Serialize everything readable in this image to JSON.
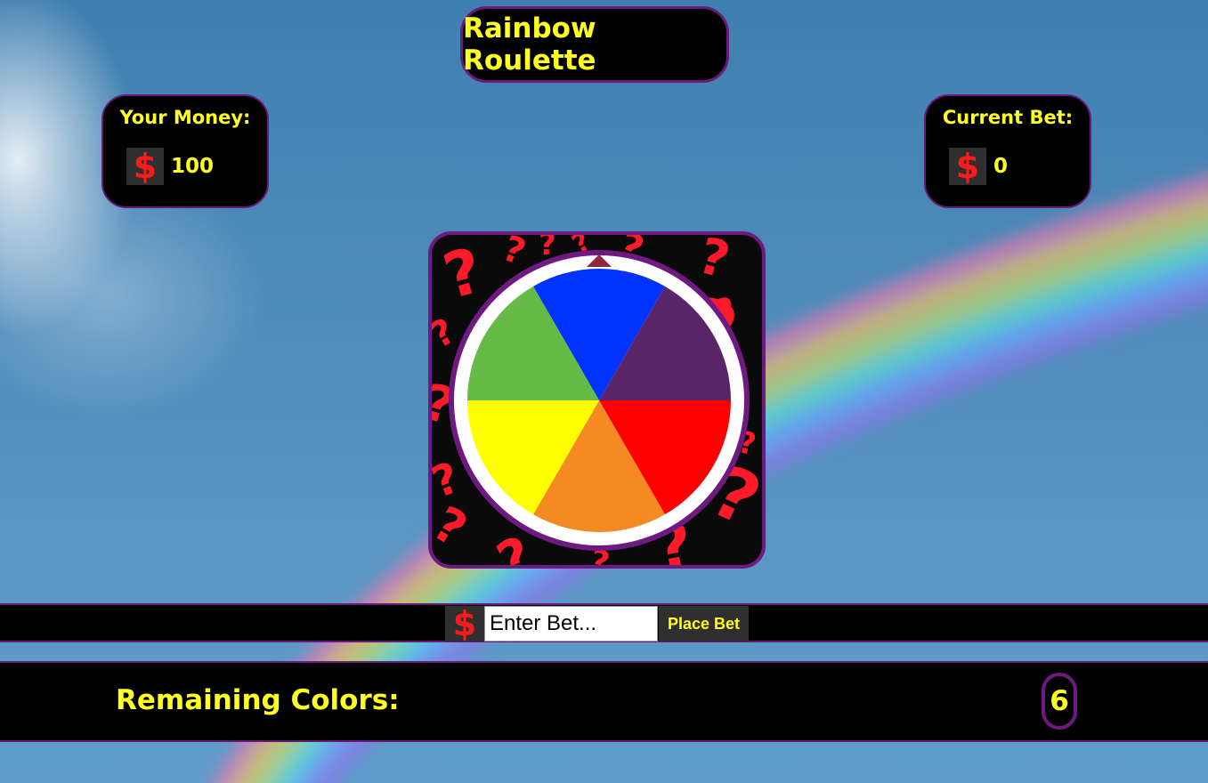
{
  "game": {
    "title": "Rainbow Roulette"
  },
  "money": {
    "label": "Your Money:",
    "currency_symbol": "$",
    "value": "100"
  },
  "current_bet": {
    "label": "Current Bet:",
    "currency_symbol": "$",
    "value": "0"
  },
  "wheel": {
    "segments": [
      {
        "color_name": "blue",
        "color": "#0033ff"
      },
      {
        "color_name": "purple",
        "color": "#5a2468"
      },
      {
        "color_name": "red",
        "color": "#ff0000"
      },
      {
        "color_name": "orange",
        "color": "#f58a22"
      },
      {
        "color_name": "yellow",
        "color": "#ffff00"
      },
      {
        "color_name": "green",
        "color": "#66bb46"
      }
    ],
    "pointer_icon": "pointer-arrow-icon",
    "background_pattern": "question-mark-pattern"
  },
  "bet_bar": {
    "currency_symbol": "$",
    "input_placeholder": "Enter Bet...",
    "input_value": "",
    "button_label": "Place Bet"
  },
  "remaining": {
    "label": "Remaining Colors:",
    "count": "6"
  },
  "colors": {
    "accent_text": "#ffff20",
    "border_purple": "#6a1a7a",
    "panel_bg": "#000000",
    "dollar_red": "#ff1a1a"
  }
}
